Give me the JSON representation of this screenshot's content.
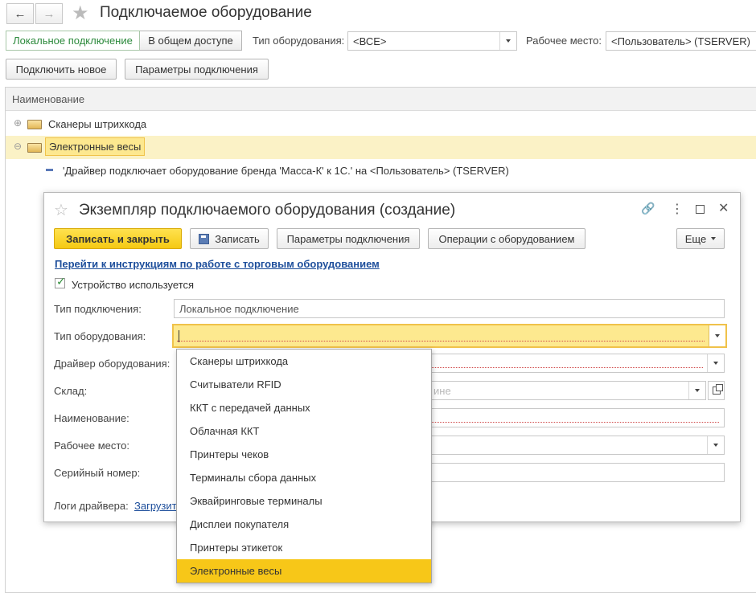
{
  "main": {
    "title": "Подключаемое оборудование",
    "tabs": [
      {
        "label": "Локальное подключение"
      },
      {
        "label": "В общем доступе"
      }
    ],
    "filters": {
      "equipment_type_label": "Тип оборудования:",
      "equipment_type_value": "<ВСЕ>",
      "workplace_label": "Рабочее место:",
      "workplace_value": "<Пользователь> (TSERVER)"
    },
    "toolbar": {
      "connect_new": "Подключить новое",
      "connection_params": "Параметры подключения"
    },
    "list": {
      "column_header": "Наименование",
      "rows": [
        {
          "label": "Сканеры штрихкода"
        },
        {
          "label": "Электронные весы"
        },
        {
          "label": "'Драйвер подключает оборудование бренда 'Масса-К' к 1С.' на <Пользователь> (TSERVER)"
        }
      ]
    }
  },
  "dialog": {
    "title": "Экземпляр подключаемого оборудования (создание)",
    "buttons": {
      "save_close": "Записать и закрыть",
      "save": "Записать",
      "conn_params": "Параметры подключения",
      "operations": "Операции с оборудованием",
      "more": "Еще"
    },
    "link": "Перейти к инструкциям по работе с торговым оборудованием",
    "checkbox_label": "Устройство используется",
    "fields": {
      "connection_type_label": "Тип подключения:",
      "connection_type_value": "Локальное подключение",
      "equipment_type_label": "Тип оборудования:",
      "driver_label": "Драйвер оборудования:",
      "warehouse_label": "Склад:",
      "warehouse_placeholder_tail": "ине",
      "name_label": "Наименование:",
      "workplace_label": "Рабочее место:",
      "serial_label": "Серийный номер:",
      "logs_label": "Логи драйвера:",
      "logs_link": "Загрузит"
    }
  },
  "dropdown": {
    "items": [
      {
        "label": "Сканеры штрихкода"
      },
      {
        "label": "Считыватели RFID"
      },
      {
        "label": "ККТ с передачей данных"
      },
      {
        "label": "Облачная ККТ"
      },
      {
        "label": "Принтеры чеков"
      },
      {
        "label": "Терминалы сбора данных"
      },
      {
        "label": "Эквайринговые терминалы"
      },
      {
        "label": "Дисплеи покупателя"
      },
      {
        "label": "Принтеры этикеток"
      },
      {
        "label": "Электронные весы"
      }
    ]
  }
}
